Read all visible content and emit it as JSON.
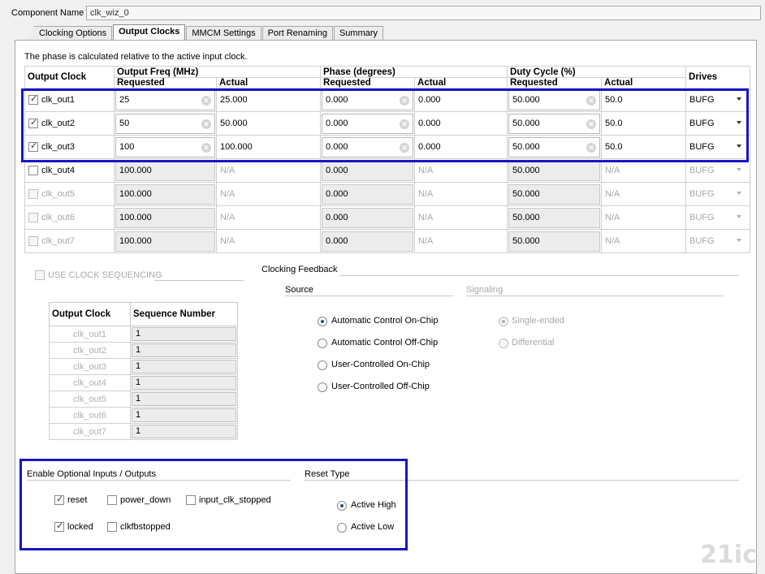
{
  "component": {
    "label": "Component Name",
    "value": "clk_wiz_0"
  },
  "tabs": [
    "Clocking Options",
    "Output Clocks",
    "MMCM Settings",
    "Port Renaming",
    "Summary"
  ],
  "note": "The phase is calculated relative to the active input clock.",
  "table": {
    "headers": {
      "output_clock": "Output Clock",
      "freq": "Output Freq (MHz)",
      "phase": "Phase (degrees)",
      "duty": "Duty Cycle (%)",
      "drives": "Drives",
      "requested": "Requested",
      "actual": "Actual"
    },
    "rows": [
      {
        "name": "clk_out1",
        "freq_req": "25",
        "freq_act": "25.000",
        "phase_req": "0.000",
        "phase_act": "0.000",
        "duty_req": "50.000",
        "duty_act": "50.0",
        "drives": "BUFG"
      },
      {
        "name": "clk_out2",
        "freq_req": "50",
        "freq_act": "50.000",
        "phase_req": "0.000",
        "phase_act": "0.000",
        "duty_req": "50.000",
        "duty_act": "50.0",
        "drives": "BUFG"
      },
      {
        "name": "clk_out3",
        "freq_req": "100",
        "freq_act": "100.000",
        "phase_req": "0.000",
        "phase_act": "0.000",
        "duty_req": "50.000",
        "duty_act": "50.0",
        "drives": "BUFG"
      },
      {
        "name": "clk_out4",
        "freq_req": "100.000",
        "freq_act": "N/A",
        "phase_req": "0.000",
        "phase_act": "N/A",
        "duty_req": "50.000",
        "duty_act": "N/A",
        "drives": "BUFG"
      },
      {
        "name": "clk_out5",
        "freq_req": "100.000",
        "freq_act": "N/A",
        "phase_req": "0.000",
        "phase_act": "N/A",
        "duty_req": "50.000",
        "duty_act": "N/A",
        "drives": "BUFG"
      },
      {
        "name": "clk_out6",
        "freq_req": "100.000",
        "freq_act": "N/A",
        "phase_req": "0.000",
        "phase_act": "N/A",
        "duty_req": "50.000",
        "duty_act": "N/A",
        "drives": "BUFG"
      },
      {
        "name": "clk_out7",
        "freq_req": "100.000",
        "freq_act": "N/A",
        "phase_req": "0.000",
        "phase_act": "N/A",
        "duty_req": "50.000",
        "duty_act": "N/A",
        "drives": "BUFG"
      }
    ]
  },
  "clock_sequencing": {
    "label": "USE CLOCK SEQUENCING",
    "headers": {
      "clock": "Output Clock",
      "seq": "Sequence Number"
    },
    "rows": [
      {
        "name": "clk_out1",
        "seq": "1"
      },
      {
        "name": "clk_out2",
        "seq": "1"
      },
      {
        "name": "clk_out3",
        "seq": "1"
      },
      {
        "name": "clk_out4",
        "seq": "1"
      },
      {
        "name": "clk_out5",
        "seq": "1"
      },
      {
        "name": "clk_out6",
        "seq": "1"
      },
      {
        "name": "clk_out7",
        "seq": "1"
      }
    ]
  },
  "feedback": {
    "title": "Clocking Feedback",
    "source_label": "Source",
    "signaling_label": "Signaling",
    "source_options": [
      "Automatic Control On-Chip",
      "Automatic Control Off-Chip",
      "User-Controlled On-Chip",
      "User-Controlled Off-Chip"
    ],
    "signaling_options": [
      "Single-ended",
      "Differential"
    ]
  },
  "optional_io": {
    "title": "Enable Optional Inputs / Outputs",
    "items": [
      "reset",
      "power_down",
      "input_clk_stopped",
      "locked",
      "clkfbstopped"
    ]
  },
  "reset_type": {
    "title": "Reset Type",
    "options": [
      "Active High",
      "Active Low"
    ]
  },
  "watermark": "21ic"
}
